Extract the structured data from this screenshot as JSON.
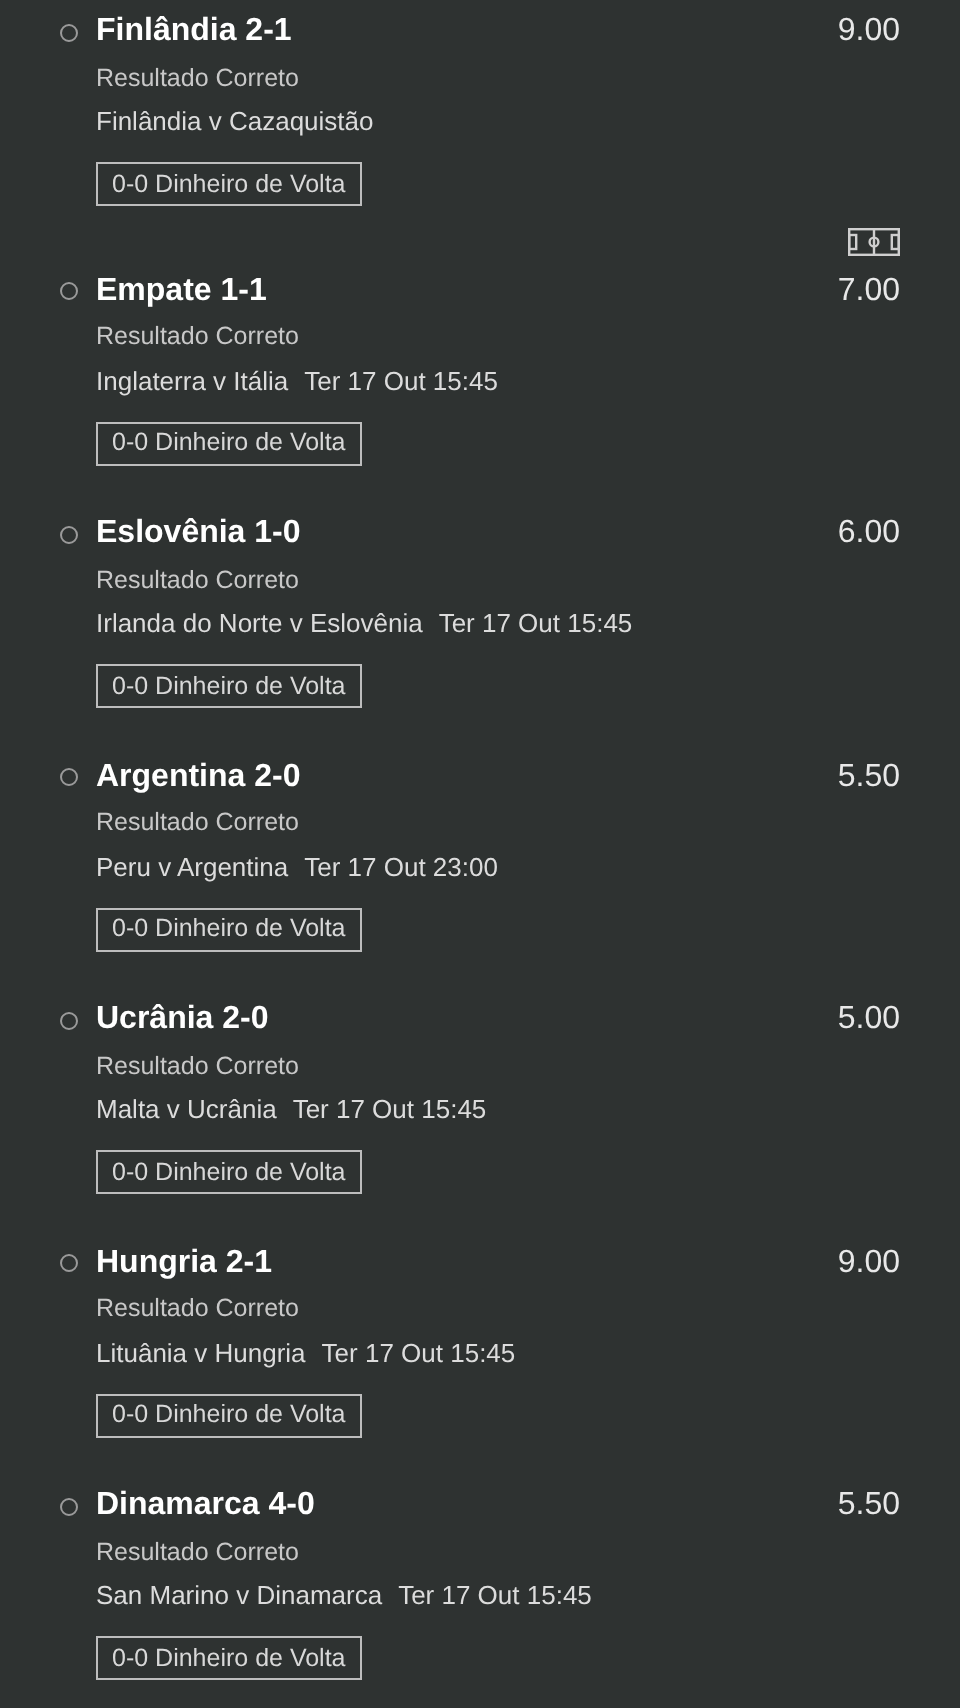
{
  "selections": [
    {
      "name": "Finlândia 2-1",
      "market": "Resultado Correto",
      "match": "Finlândia v Cazaquistão",
      "odds": "9.00",
      "tag": "0-0 Dinheiro de Volta",
      "selected": false,
      "pitch_icon": true
    },
    {
      "name": "Empate 1-1",
      "market": "Resultado Correto",
      "match": "Inglaterra v Itália",
      "time": "Ter 17 Out 15:45",
      "odds": "7.00",
      "tag": "0-0 Dinheiro de Volta",
      "selected": false
    },
    {
      "name": "Eslovênia 1-0",
      "market": "Resultado Correto",
      "match": "Irlanda do Norte v Eslovênia",
      "time": "Ter 17 Out 15:45",
      "odds": "6.00",
      "tag": "0-0 Dinheiro de Volta",
      "selected": false
    },
    {
      "name": "Argentina 2-0",
      "market": "Resultado Correto",
      "match": "Peru v Argentina",
      "time": "Ter 17 Out 23:00",
      "odds": "5.50",
      "tag": "0-0 Dinheiro de Volta",
      "selected": false
    },
    {
      "name": "Ucrânia 2-0",
      "market": "Resultado Correto",
      "match": "Malta v Ucrânia",
      "time": "Ter 17 Out 15:45",
      "odds": "5.00",
      "tag": "0-0 Dinheiro de Volta",
      "selected": false
    },
    {
      "name": "Hungria 2-1",
      "market": "Resultado Correto",
      "match": "Lituânia v Hungria",
      "time": "Ter 17 Out 15:45",
      "odds": "9.00",
      "tag": "0-0 Dinheiro de Volta",
      "selected": false
    },
    {
      "name": "Dinamarca 4-0",
      "market": "Resultado Correto",
      "match": "San Marino v Dinamarca",
      "time": "Ter 17 Out 15:45",
      "odds": "5.50",
      "tag": "0-0 Dinheiro de Volta",
      "selected": false
    }
  ]
}
